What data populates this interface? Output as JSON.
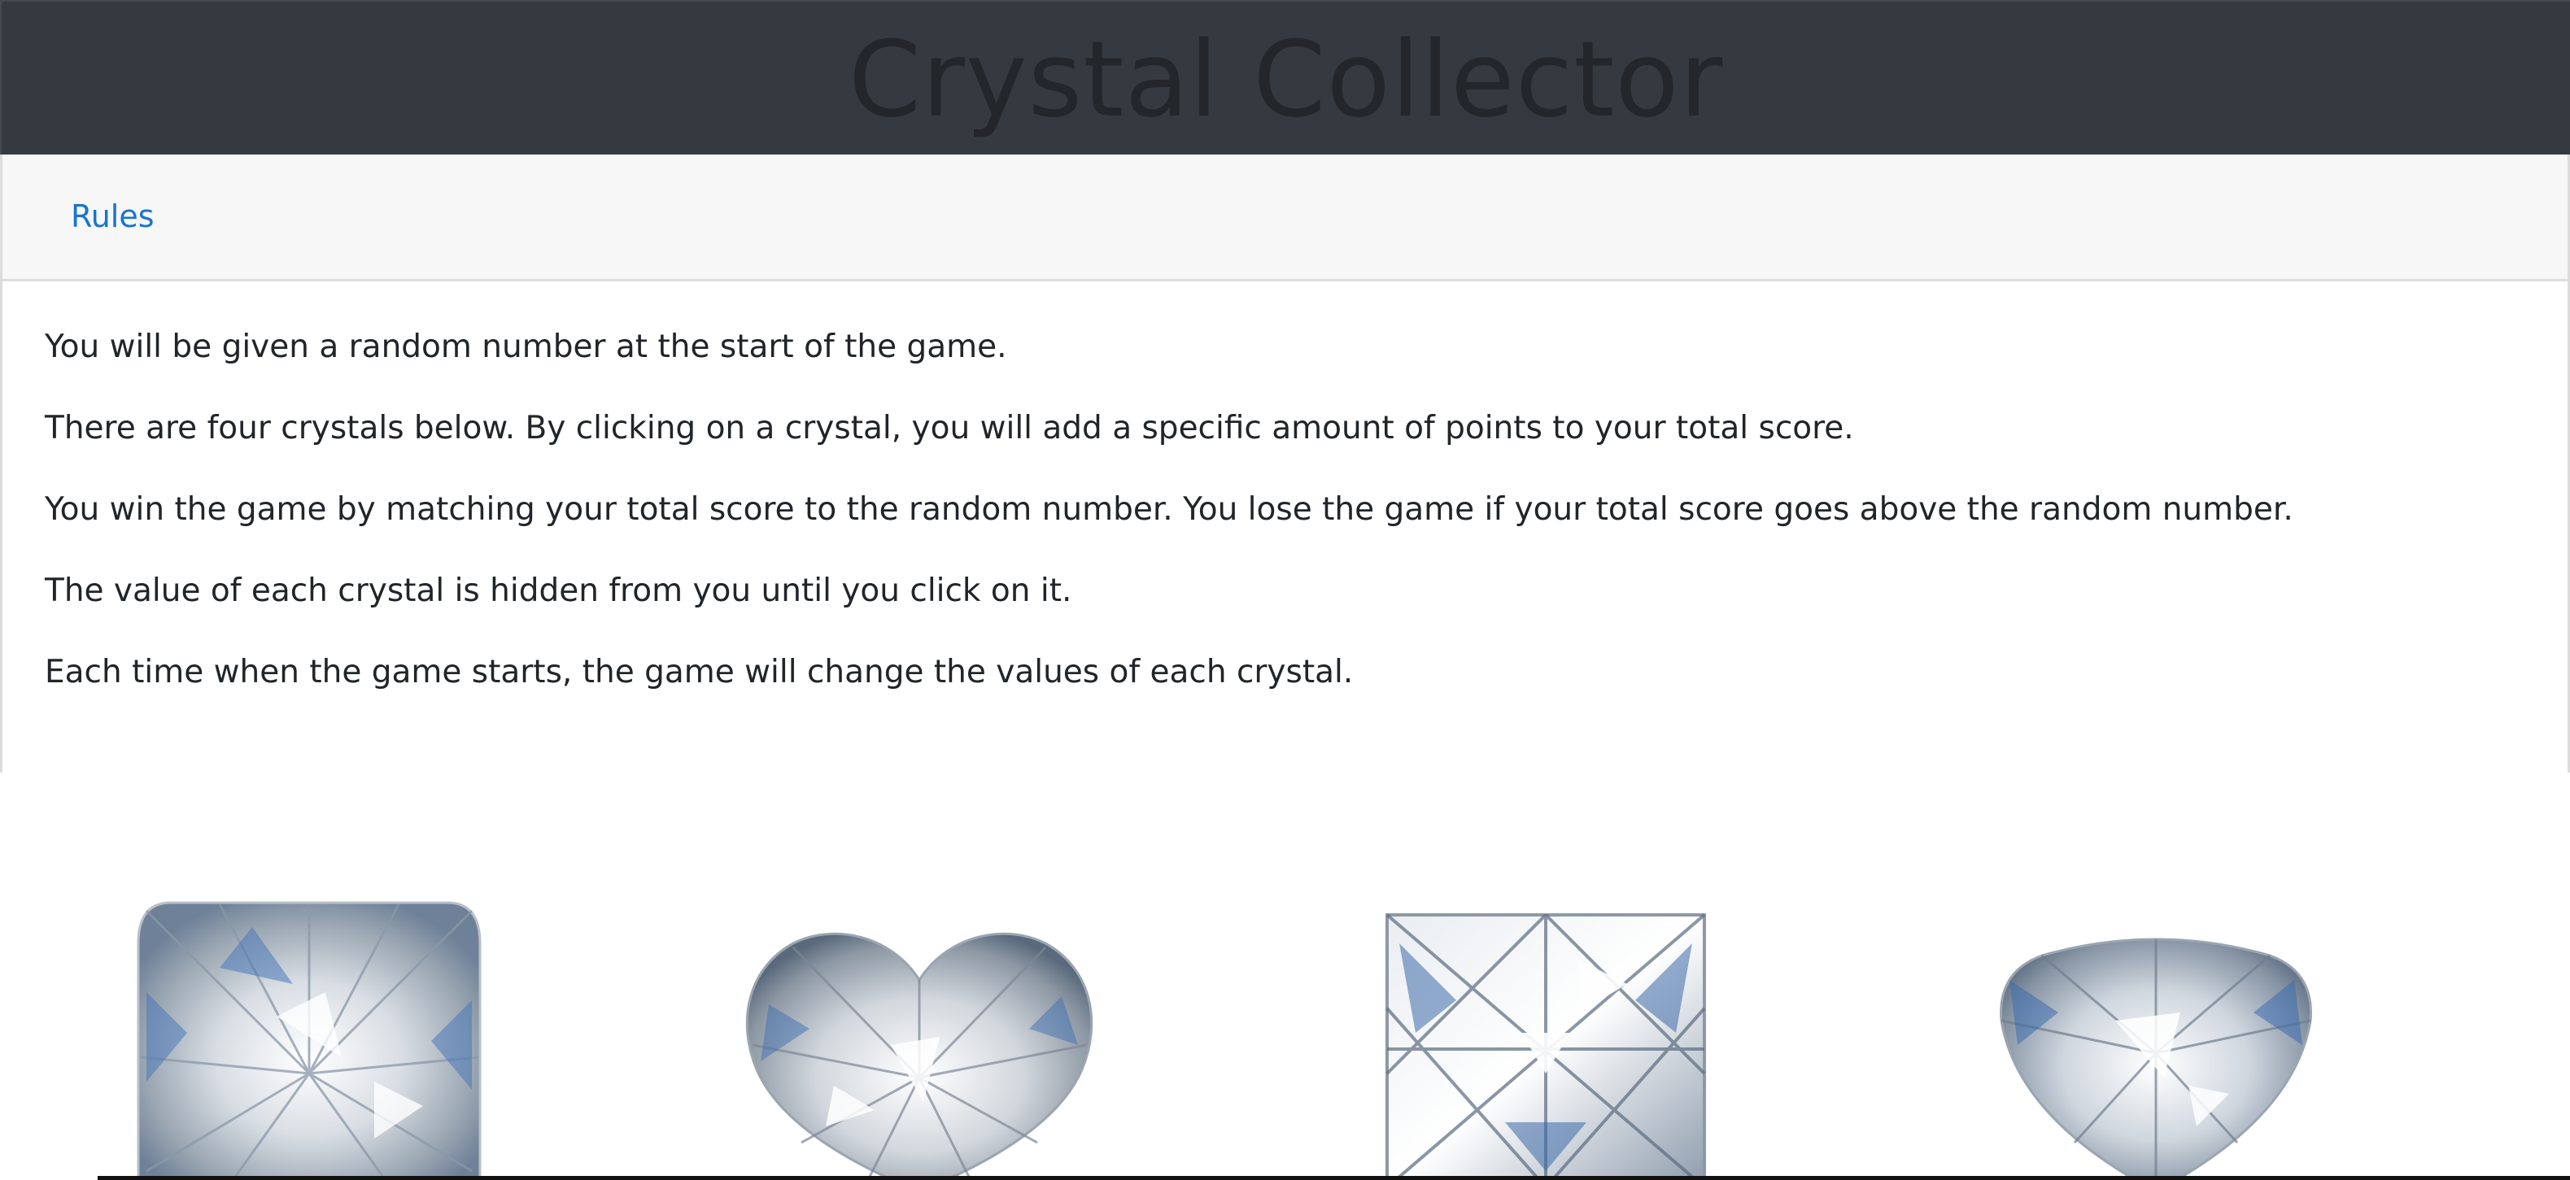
{
  "header": {
    "title": "Crystal Collector"
  },
  "rules": {
    "tab_label": "Rules",
    "paragraphs": [
      "You will be given a random number at the start of the game.",
      "There are four crystals below. By clicking on a crystal, you will add a specific amount of points to your total score.",
      "You win the game by matching your total score to the random number. You lose the game if your total score goes above the random number.",
      "The value of each crystal is hidden from you until you click on it.",
      "Each time when the game starts, the game will change the values of each crystal."
    ]
  },
  "crystals": [
    {
      "shape": "cushion-cut"
    },
    {
      "shape": "heart-cut"
    },
    {
      "shape": "princess-cut"
    },
    {
      "shape": "trillion-cut"
    }
  ],
  "colors": {
    "header_bg": "#343a40",
    "title_text": "#23272b",
    "link": "#1a73d0",
    "body_text": "#212529",
    "card_header_bg": "#f7f7f7"
  }
}
